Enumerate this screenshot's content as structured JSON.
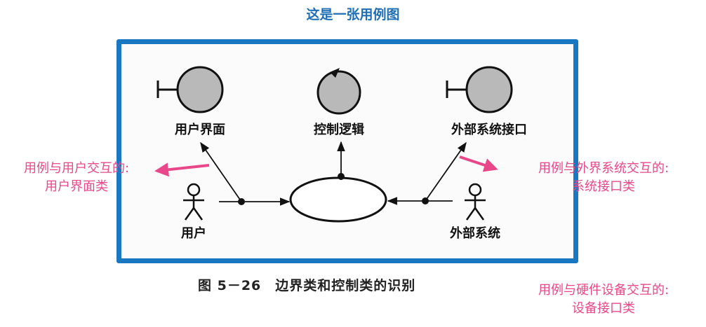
{
  "title": "这是一张用例图",
  "diagram": {
    "classes": {
      "boundary_ui": "用户界面",
      "control": "控制逻辑",
      "boundary_ext": "外部系统接口"
    },
    "actors": {
      "user": "用户",
      "external": "外部系统"
    },
    "caption": "图 5－26　边界类和控制类的识别"
  },
  "annotations": {
    "left": {
      "line1": "用例与用户交互的:",
      "line2": "用户界面类"
    },
    "right": {
      "line1": "用例与外界系统交互的:",
      "line2": "系统接口类"
    },
    "bottom": {
      "line1": "用例与硬件设备交互的:",
      "line2": "设备接口类"
    }
  },
  "colors": {
    "title": "#1f6fb5",
    "frame": "#1a78c2",
    "annotation": "#e8488a",
    "class_fill": "#b9b9b9"
  }
}
